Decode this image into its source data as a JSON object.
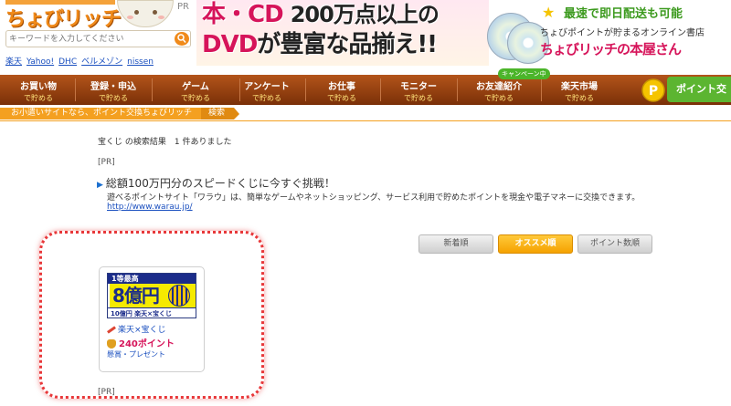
{
  "header": {
    "logo_text": "ちょびリッチ",
    "pr_label": "PR",
    "search_placeholder": "キーワードを入力してください",
    "quick_links": [
      "楽天",
      "Yahoo!",
      "DHC",
      "ベルメゾン",
      "nissen"
    ]
  },
  "banner": {
    "line1_a": "本・CD",
    "line1_b": "200万点以上の",
    "line2_a": "DVD",
    "line2_b": "が",
    "line2_c": "豊富な品揃え!!",
    "right_1": "最速で即日配送も可能",
    "right_2": "ちょびポイントが貯まるオンライン書店",
    "right_3": "ちょびリッチの本屋さん"
  },
  "nav": {
    "items": [
      {
        "title": "お買い物",
        "sub": "で貯める"
      },
      {
        "title": "登録・申込",
        "sub": "で貯める"
      },
      {
        "title": "ゲーム",
        "sub": "で貯める"
      },
      {
        "title": "アンケート",
        "sub": "で貯める"
      },
      {
        "title": "お仕事",
        "sub": "で貯める"
      },
      {
        "title": "モニター",
        "sub": "で貯める"
      },
      {
        "title": "お友達紹介",
        "sub": "で貯める"
      },
      {
        "title": "楽天市場",
        "sub": "で貯める"
      }
    ],
    "campaign_badge": "キャンペーン中",
    "point_exchange": "ポイント交"
  },
  "breadcrumb": {
    "home": "お小遣いサイトなら、ポイント交換ちょびリッチ",
    "current": "検索"
  },
  "search_result": {
    "query": "宝くじ",
    "text": "の検索結果　1 件ありました"
  },
  "ad": {
    "pr": "[PR]",
    "title": "総額100万円分のスピードくじに今すぐ挑戦！",
    "desc": "遊べるポイントサイト「ワラウ」は、簡単なゲームやネットショッピング、サービス利用で貯めたポイントを現金や電子マネーに交換できます。",
    "url": "http://www.warau.jp/"
  },
  "sort": {
    "newest": "新着順",
    "recommended": "オススメ順",
    "points": "ポイント数順"
  },
  "card": {
    "banner_top": "1等最高",
    "banner_big": "8億円",
    "banner_bottom": "10億円 楽天×宝くじ",
    "link": "楽天×宝くじ",
    "points": "240ポイント",
    "category": "懸賞・プレゼント"
  },
  "footer_pr": "[PR]",
  "colors": {
    "nav_bg": "#8a3a0e",
    "accent_orange": "#f4a020",
    "point_green": "#5cb531",
    "highlight_red": "#e8383a"
  }
}
